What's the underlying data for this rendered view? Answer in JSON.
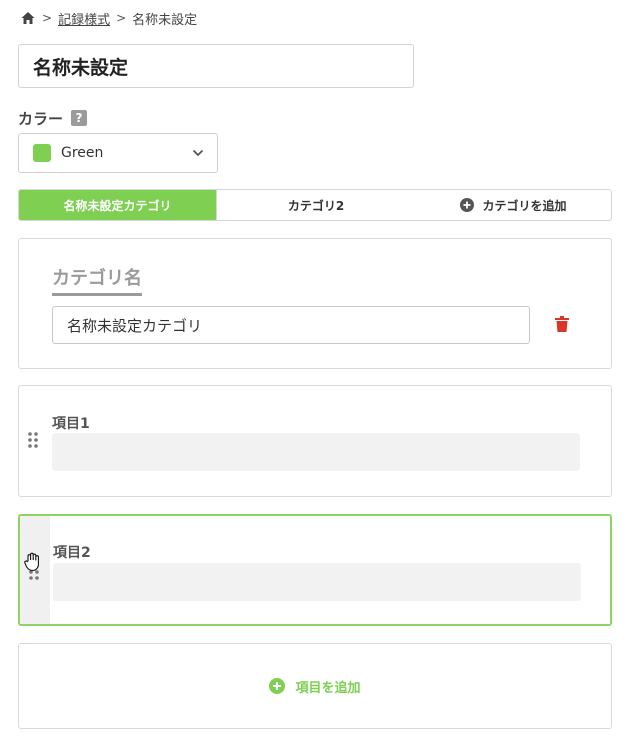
{
  "breadcrumb": {
    "home_icon": "home-icon",
    "separator": ">",
    "link": "記録様式",
    "current": "名称未設定"
  },
  "title_input": {
    "value": "名称未設定"
  },
  "color": {
    "label": "カラー",
    "help": "?",
    "selected": "Green",
    "swatch_color": "#7ecf52"
  },
  "tabs": [
    {
      "label": "名称未設定カテゴリ",
      "active": true
    },
    {
      "label": "カテゴリ2",
      "active": false
    },
    {
      "label": "カテゴリを追加",
      "icon": "plus-circle-icon"
    }
  ],
  "category": {
    "heading": "カテゴリ名",
    "name_value": "名称未設定カテゴリ",
    "delete_icon": "trash-icon",
    "delete_color": "#d9362b"
  },
  "items": [
    {
      "label": "項目1",
      "value": ""
    },
    {
      "label": "項目2",
      "value": ""
    }
  ],
  "add_item": {
    "label": "項目を追加",
    "icon": "plus-circle-icon"
  },
  "accent_color": "#7ecf52"
}
